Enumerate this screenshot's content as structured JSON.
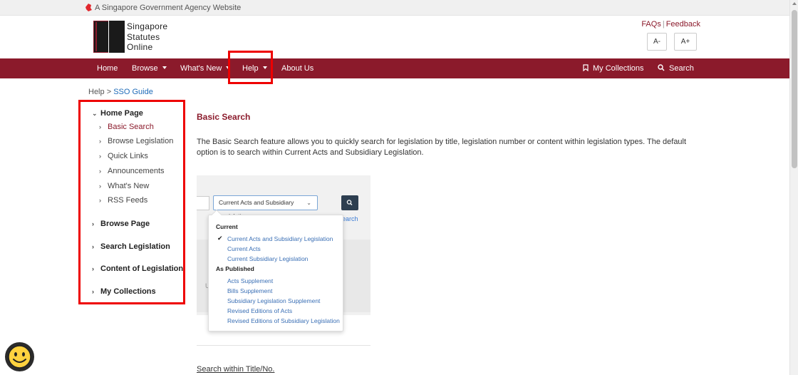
{
  "gov_strip": {
    "text": "A Singapore Government Agency Website"
  },
  "logo": {
    "line1": "Singapore",
    "line2": "Statutes",
    "line3": "Online"
  },
  "top_links": {
    "faqs": "FAQs",
    "separator": "|",
    "feedback": "Feedback"
  },
  "font_size": {
    "decrease": "A-",
    "increase": "A+"
  },
  "nav": {
    "home": "Home",
    "browse": "Browse",
    "whats_new": "What's New",
    "help": "Help",
    "about": "About Us",
    "my_collections": "My Collections",
    "search": "Search"
  },
  "breadcrumb": {
    "parent": "Help",
    "separator": ">",
    "current": "SSO Guide"
  },
  "sidebar": {
    "home_page": "Home Page",
    "home_items": [
      "Basic Search",
      "Browse Legislation",
      "Quick Links",
      "Announcements",
      "What's New",
      "RSS Feeds"
    ],
    "browse_page": "Browse Page",
    "search_legislation": "Search Legislation",
    "content_of_legislation": "Content of Legislation",
    "my_collections": "My Collections"
  },
  "main": {
    "title": "Basic Search",
    "description": "The Basic Search feature allows you to quickly search for legislation by title, legislation number or content within legislation types. The default option is to search within Current Acts and Subsidiary Legislation."
  },
  "screenshot": {
    "select_value": "Current Acts and Subsidiary Legislation",
    "link_fragment": "earch",
    "panel_letter": "U",
    "dropdown": {
      "group_current": "Current",
      "current_options": [
        "Current Acts and Subsidiary Legislation",
        "Current Acts",
        "Current Subsidiary Legislation"
      ],
      "group_published": "As Published",
      "published_options": [
        "Acts Supplement",
        "Bills Supplement",
        "Subsidiary Legislation Supplement",
        "Revised Editions of Acts",
        "Revised Editions of Subsidiary Legislation"
      ]
    }
  },
  "bottom": {
    "link": "Search within Title/No."
  },
  "colors": {
    "brand": "#8b1a2b",
    "highlight": "#ee0000",
    "link": "#1e6bb8"
  }
}
